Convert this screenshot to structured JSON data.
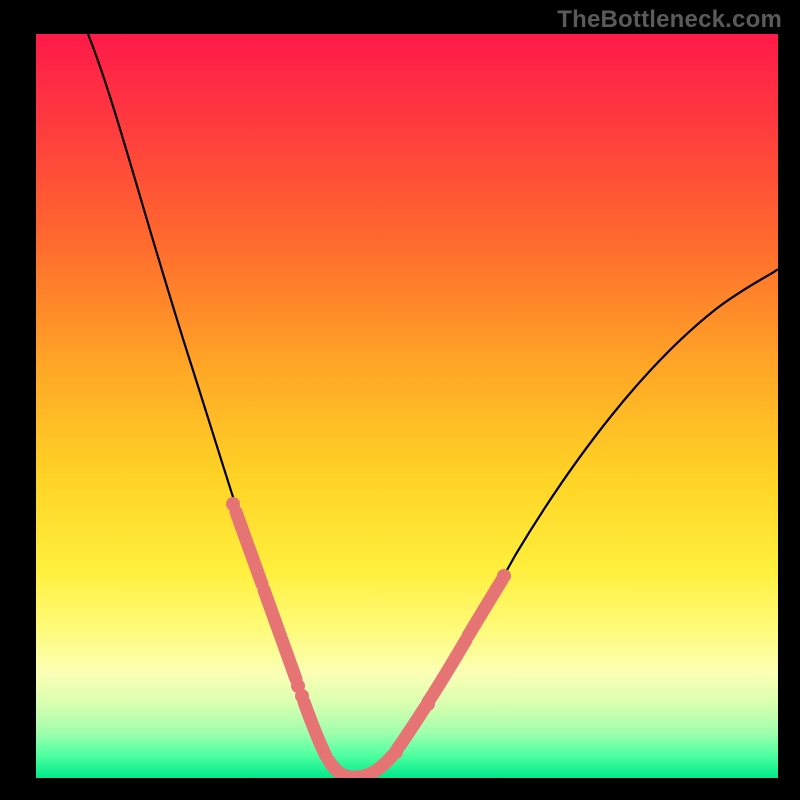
{
  "watermark": "TheBottleneck.com",
  "chart_data": {
    "type": "line",
    "title": "",
    "xlabel": "",
    "ylabel": "",
    "xlim": [
      0,
      100
    ],
    "ylim": [
      0,
      100
    ],
    "grid": false,
    "legend": false,
    "series": [
      {
        "name": "bottleneck-curve",
        "x": [
          7,
          10,
          15,
          20,
          24,
          27,
          30,
          32,
          34,
          35,
          36,
          38,
          40,
          42,
          44,
          46,
          50,
          55,
          60,
          66,
          72,
          78,
          85,
          92,
          100
        ],
        "y": [
          100,
          88,
          72,
          56,
          44,
          34,
          24,
          17,
          11,
          8,
          5,
          2,
          0,
          0,
          1,
          2,
          5,
          10,
          17,
          25,
          33,
          41,
          49,
          57,
          64
        ],
        "color": "#000000"
      }
    ],
    "highlight_segments": [
      {
        "name": "left-band-upper",
        "x_range": [
          27,
          30
        ],
        "y_range": [
          24,
          34
        ]
      },
      {
        "name": "left-band-mid",
        "x_range": [
          30,
          34
        ],
        "y_range": [
          11,
          24
        ]
      },
      {
        "name": "left-band-low",
        "x_range": [
          35,
          38
        ],
        "y_range": [
          2,
          8
        ]
      },
      {
        "name": "valley-left",
        "x_range": [
          38,
          42
        ],
        "y_range": [
          0,
          2
        ]
      },
      {
        "name": "valley-right",
        "x_range": [
          42,
          47
        ],
        "y_range": [
          0,
          3
        ]
      },
      {
        "name": "right-band-low",
        "x_range": [
          48,
          51
        ],
        "y_range": [
          4,
          7
        ]
      },
      {
        "name": "right-band-mid",
        "x_range": [
          51,
          56
        ],
        "y_range": [
          7,
          13
        ]
      },
      {
        "name": "right-band-upper",
        "x_range": [
          56,
          61
        ],
        "y_range": [
          13,
          20
        ]
      }
    ],
    "highlight_points": [
      {
        "x": 26.5,
        "y": 36
      },
      {
        "x": 34.5,
        "y": 10
      },
      {
        "x": 35.3,
        "y": 7.5
      },
      {
        "x": 47.5,
        "y": 3.5
      },
      {
        "x": 51.5,
        "y": 7
      },
      {
        "x": 61,
        "y": 19.5
      }
    ],
    "colors": {
      "highlight": "#E77474",
      "curve": "#000000"
    }
  }
}
